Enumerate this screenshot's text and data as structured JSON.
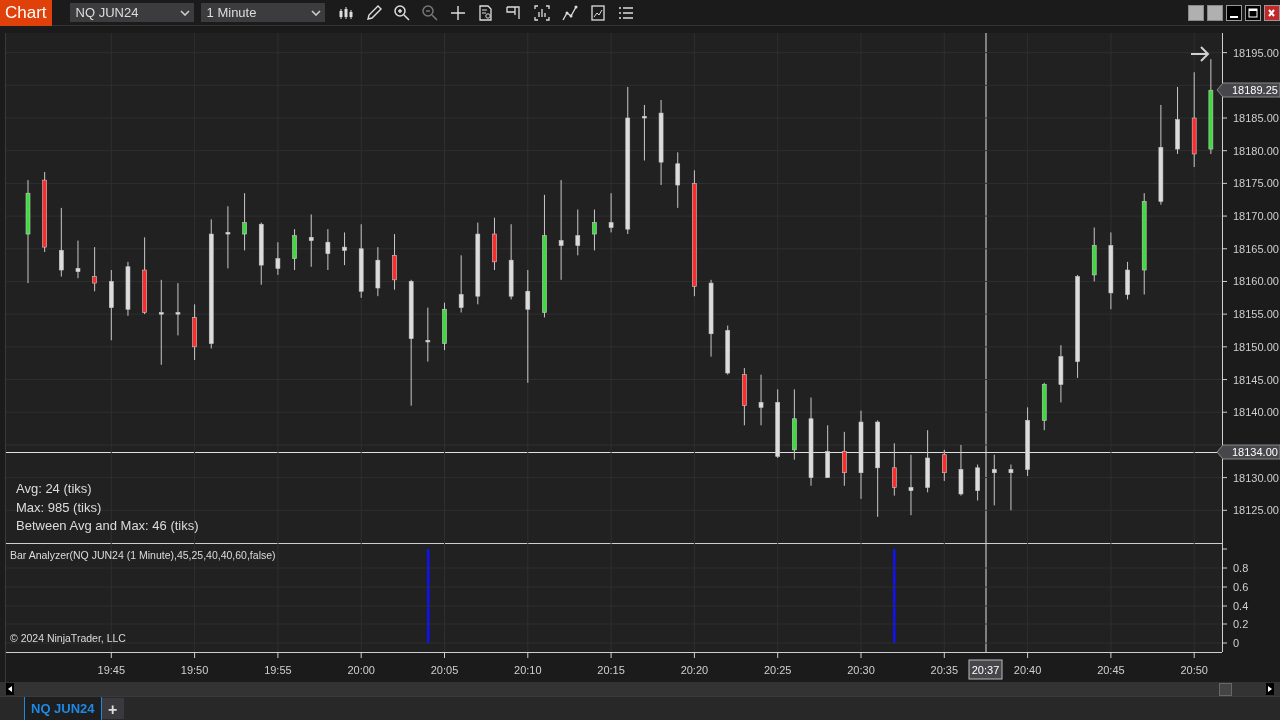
{
  "toolbar": {
    "app_button": "Chart",
    "instrument": "NQ JUN24",
    "interval": "1 Minute"
  },
  "price_chart": {
    "last_price": "18189.25",
    "crosshair_price": "18134.00",
    "crosshair_time": "20:37",
    "chart_data": {
      "type": "candlestick",
      "grid": true,
      "ylim": [
        18103.33,
        18198
      ],
      "categories": [
        null,
        null,
        null,
        null,
        null,
        "19:45",
        null,
        null,
        null,
        null,
        "19:50",
        null,
        null,
        null,
        null,
        "19:55",
        null,
        null,
        null,
        null,
        "20:00",
        null,
        null,
        null,
        null,
        "20:05",
        null,
        null,
        null,
        null,
        "20:10",
        null,
        null,
        null,
        null,
        "20:15",
        null,
        null,
        null,
        null,
        "20:20",
        null,
        null,
        null,
        null,
        "20:25",
        null,
        null,
        null,
        null,
        "20:30",
        null,
        null,
        null,
        null,
        "20:35",
        null,
        null,
        null,
        null,
        "20:40",
        null,
        null,
        null,
        null,
        "20:45",
        null,
        null,
        null,
        null,
        "20:50",
        null
      ],
      "ohlc": [
        [
          18167.25,
          18175.5,
          18159.75,
          18173.5
        ],
        [
          18175.5,
          18176.75,
          18164.5,
          18165.25
        ],
        [
          18164.75,
          18171.25,
          18160.75,
          18161.75
        ],
        [
          18162,
          18166.25,
          18160.5,
          18161.5
        ],
        [
          18160.75,
          18165.25,
          18158.5,
          18159.75
        ],
        [
          18160,
          18161.75,
          18151,
          18156
        ],
        [
          18162.25,
          18163,
          18154.75,
          18155.75
        ],
        [
          18161.75,
          18166.75,
          18155,
          18155.25
        ],
        [
          18155.25,
          18160.25,
          18147.25,
          18155
        ],
        [
          18155.25,
          18159.75,
          18151.75,
          18155
        ],
        [
          18154.5,
          18156.5,
          18148,
          18150
        ],
        [
          18167.25,
          18169.5,
          18149.75,
          18150.5
        ],
        [
          18167.5,
          18171.5,
          18162,
          18167.25
        ],
        [
          18167.25,
          18173.5,
          18164.75,
          18169
        ],
        [
          18168.75,
          18169,
          18159.5,
          18162.5
        ],
        [
          18163.5,
          18166,
          18161,
          18162
        ],
        [
          18163.5,
          18168,
          18161.75,
          18167
        ],
        [
          18166.75,
          18170.25,
          18162.25,
          18166.25
        ],
        [
          18166,
          18168,
          18161.75,
          18164.25
        ],
        [
          18165.25,
          18167.5,
          18162.5,
          18164.75
        ],
        [
          18165,
          18168.75,
          18157.5,
          18158.5
        ],
        [
          18163.25,
          18165.25,
          18157.75,
          18159
        ],
        [
          18164,
          18167.25,
          18158.75,
          18160.25
        ],
        [
          18160,
          18160.25,
          18141,
          18151.25
        ],
        [
          18151,
          18156,
          18147.75,
          18150.75
        ],
        [
          18150.5,
          18156.75,
          18149.5,
          18155.75
        ],
        [
          18158,
          18164,
          18155.25,
          18156
        ],
        [
          18167.25,
          18169,
          18156.5,
          18157.75
        ],
        [
          18167.25,
          18169.75,
          18161.75,
          18163
        ],
        [
          18163.25,
          18168.75,
          18157.25,
          18157.75
        ],
        [
          18158.5,
          18161.75,
          18144.5,
          18155.75
        ],
        [
          18155.25,
          18173.25,
          18154.5,
          18167
        ],
        [
          18166.25,
          18175.5,
          18160.25,
          18165.5
        ],
        [
          18167,
          18171,
          18164,
          18165.5
        ],
        [
          18167.25,
          18171,
          18164.75,
          18169
        ],
        [
          18169,
          18173.5,
          18167.5,
          18168.25
        ],
        [
          18185,
          18189.75,
          18167.25,
          18168
        ],
        [
          18185.25,
          18187,
          18178.5,
          18185
        ],
        [
          18185.75,
          18187.75,
          18174.75,
          18178.25
        ],
        [
          18178,
          18179.75,
          18171.25,
          18174.75
        ],
        [
          18175,
          18177,
          18157.75,
          18159.25
        ],
        [
          18159.75,
          18160.25,
          18148.5,
          18152
        ],
        [
          18152.5,
          18153.25,
          18145.75,
          18146
        ],
        [
          18145.75,
          18146.75,
          18138,
          18141
        ],
        [
          18141.5,
          18145.75,
          18138,
          18140.75
        ],
        [
          18141.5,
          18143.5,
          18133,
          18133.25
        ],
        [
          18134.25,
          18143.5,
          18132.75,
          18139
        ],
        [
          18139,
          18142.25,
          18128.75,
          18130
        ],
        [
          18134,
          18138,
          18130,
          18130
        ],
        [
          18134,
          18137,
          18128.75,
          18130.75
        ],
        [
          18138.5,
          18140.25,
          18126.75,
          18130.75
        ],
        [
          18138.5,
          18138.75,
          18124,
          18131.5
        ],
        [
          18131.5,
          18135.25,
          18127.25,
          18128.5
        ],
        [
          18128.5,
          18133.5,
          18124.25,
          18128
        ],
        [
          18133,
          18137.25,
          18127.75,
          18128.5
        ],
        [
          18133.5,
          18134.25,
          18129.5,
          18130.75
        ],
        [
          18131.25,
          18135,
          18127.25,
          18127.5
        ],
        [
          18131.5,
          18132,
          18126.5,
          18128
        ],
        [
          18131.25,
          18133.5,
          18125.75,
          18130.75
        ],
        [
          18131.25,
          18132,
          18125,
          18130.75
        ],
        [
          18138.75,
          18140.75,
          18130.25,
          18131.25
        ],
        [
          18138.75,
          18144.5,
          18137.25,
          18144.25
        ],
        [
          18148.5,
          18150.25,
          18141.5,
          18144.25
        ],
        [
          18160.75,
          18161,
          18145.25,
          18147.75
        ],
        [
          18161,
          18168.25,
          18160,
          18165.5
        ],
        [
          18165.5,
          18167.5,
          18155.75,
          18158.25
        ],
        [
          18161.75,
          18163,
          18157.25,
          18158
        ],
        [
          18161.75,
          18173.5,
          18158,
          18172.25
        ],
        [
          18180.5,
          18187,
          18171.75,
          18172.25
        ],
        [
          18184.75,
          18189.75,
          18179.5,
          18180.25
        ],
        [
          18185,
          18192,
          18177.5,
          18179.5
        ],
        [
          18180.25,
          18194,
          18179.5,
          18189.25
        ]
      ],
      "colors": [
        "#3ddc3d",
        "#ff2a2a",
        "#dcdcdc",
        "#dcdcdc",
        "#ff2a2a",
        "#dcdcdc",
        "#dcdcdc",
        "#ff2a2a",
        "#dcdcdc",
        "#dcdcdc",
        "#ff2a2a",
        "#dcdcdc",
        "#dcdcdc",
        "#3ddc3d",
        "#dcdcdc",
        "#dcdcdc",
        "#3ddc3d",
        "#dcdcdc",
        "#dcdcdc",
        "#dcdcdc",
        "#dcdcdc",
        "#dcdcdc",
        "#ff2a2a",
        "#dcdcdc",
        "#dcdcdc",
        "#3ddc3d",
        "#dcdcdc",
        "#dcdcdc",
        "#ff2a2a",
        "#dcdcdc",
        "#dcdcdc",
        "#3ddc3d",
        "#dcdcdc",
        "#dcdcdc",
        "#3ddc3d",
        "#dcdcdc",
        "#dcdcdc",
        "#dcdcdc",
        "#dcdcdc",
        "#dcdcdc",
        "#ff2a2a",
        "#dcdcdc",
        "#dcdcdc",
        "#ff2a2a",
        "#dcdcdc",
        "#dcdcdc",
        "#3ddc3d",
        "#dcdcdc",
        "#dcdcdc",
        "#ff2a2a",
        "#dcdcdc",
        "#dcdcdc",
        "#ff2a2a",
        "#dcdcdc",
        "#dcdcdc",
        "#ff2a2a",
        "#dcdcdc",
        "#dcdcdc",
        "#dcdcdc",
        "#dcdcdc",
        "#dcdcdc",
        "#3ddc3d",
        "#dcdcdc",
        "#dcdcdc",
        "#3ddc3d",
        "#dcdcdc",
        "#dcdcdc",
        "#3ddc3d",
        "#dcdcdc",
        "#dcdcdc",
        "#ff2a2a",
        "#3ddc3d"
      ],
      "yticks": [
        {
          "value": 18195,
          "label": "18195.00"
        },
        {
          "value": 18185,
          "label": "18185.00"
        },
        {
          "value": 18180,
          "label": "18180.00"
        },
        {
          "value": 18175,
          "label": "18175.00"
        },
        {
          "value": 18170,
          "label": "18170.00"
        },
        {
          "value": 18165,
          "label": "18165.00"
        },
        {
          "value": 18160,
          "label": "18160.00"
        },
        {
          "value": 18155,
          "label": "18155.00"
        },
        {
          "value": 18150,
          "label": "18150.00"
        },
        {
          "value": 18145,
          "label": "18145.00"
        },
        {
          "value": 18140,
          "label": "18140.00"
        },
        {
          "value": 18130,
          "label": "18130.00"
        },
        {
          "value": 18125,
          "label": "18125.00"
        }
      ]
    }
  },
  "stats": [
    "Avg: 24 (tiks)",
    "Max: 985 (tiks)",
    "Between Avg and Max: 46 (tiks)"
  ],
  "indicator": {
    "title": "Bar Analyzer(NQ JUN24 (1 Minute),45,25,40,40,60,false)",
    "axis_labels": [
      "0.8",
      "0.6",
      "0.4",
      "0.2",
      "0"
    ]
  },
  "copyright": "© 2024 NinjaTrader, LLC",
  "tabs": [
    {
      "label": "NQ JUN24",
      "selected": true
    }
  ],
  "add_tab": "+"
}
